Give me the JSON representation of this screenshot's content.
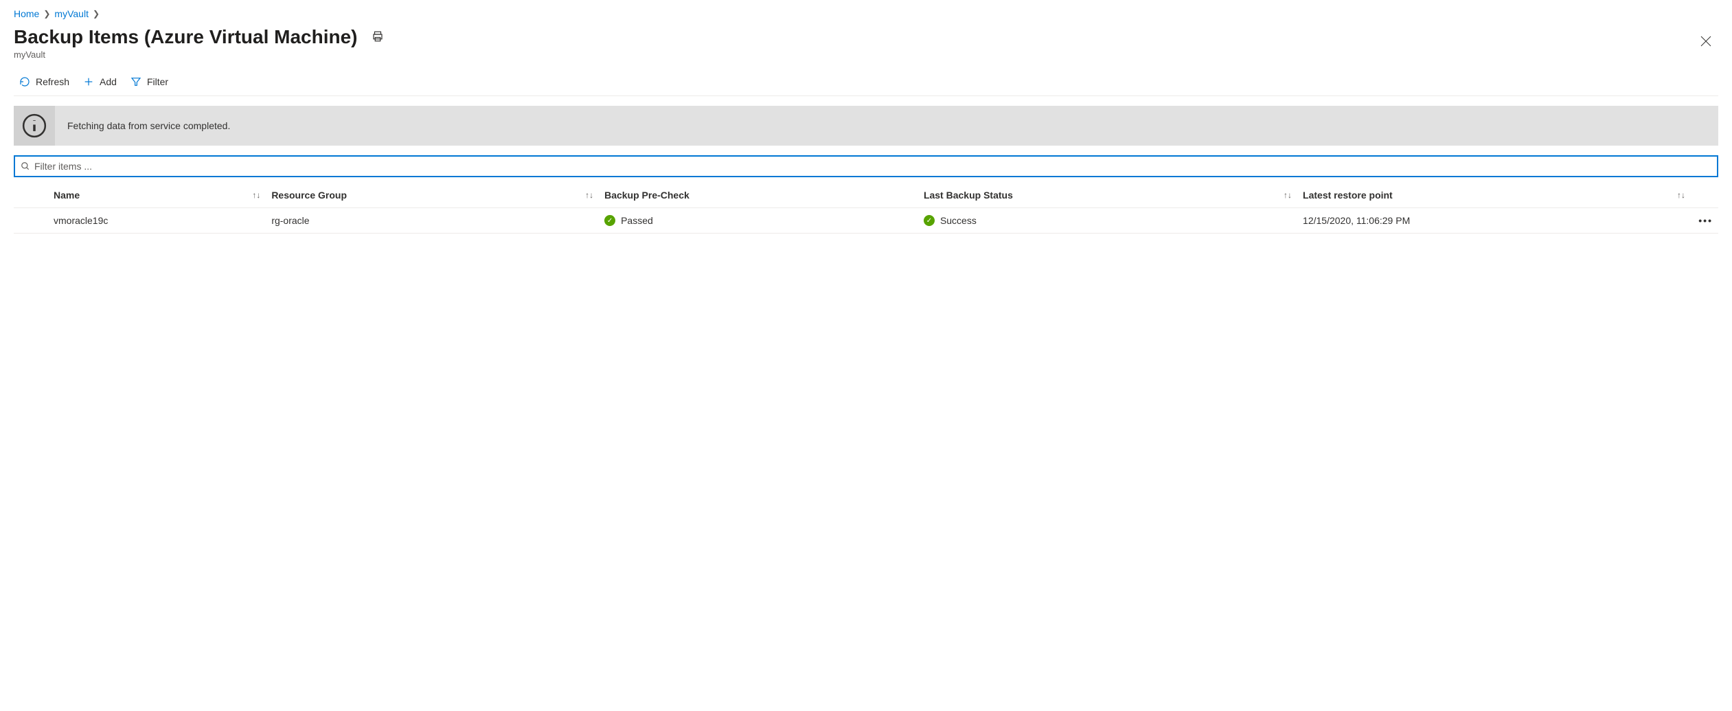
{
  "breadcrumb": {
    "home": "Home",
    "vault": "myVault"
  },
  "title": "Backup Items (Azure Virtual Machine)",
  "subtitle": "myVault",
  "toolbar": {
    "refresh": "Refresh",
    "add": "Add",
    "filter": "Filter"
  },
  "info_message": "Fetching data from service completed.",
  "filter_placeholder": "Filter items ...",
  "columns": {
    "name": "Name",
    "resource_group": "Resource Group",
    "backup_precheck": "Backup Pre-Check",
    "last_backup_status": "Last Backup Status",
    "latest_restore_point": "Latest restore point"
  },
  "rows": [
    {
      "name": "vmoracle19c",
      "resource_group": "rg-oracle",
      "precheck": "Passed",
      "last_status": "Success",
      "restore_point": "12/15/2020, 11:06:29 PM"
    }
  ]
}
